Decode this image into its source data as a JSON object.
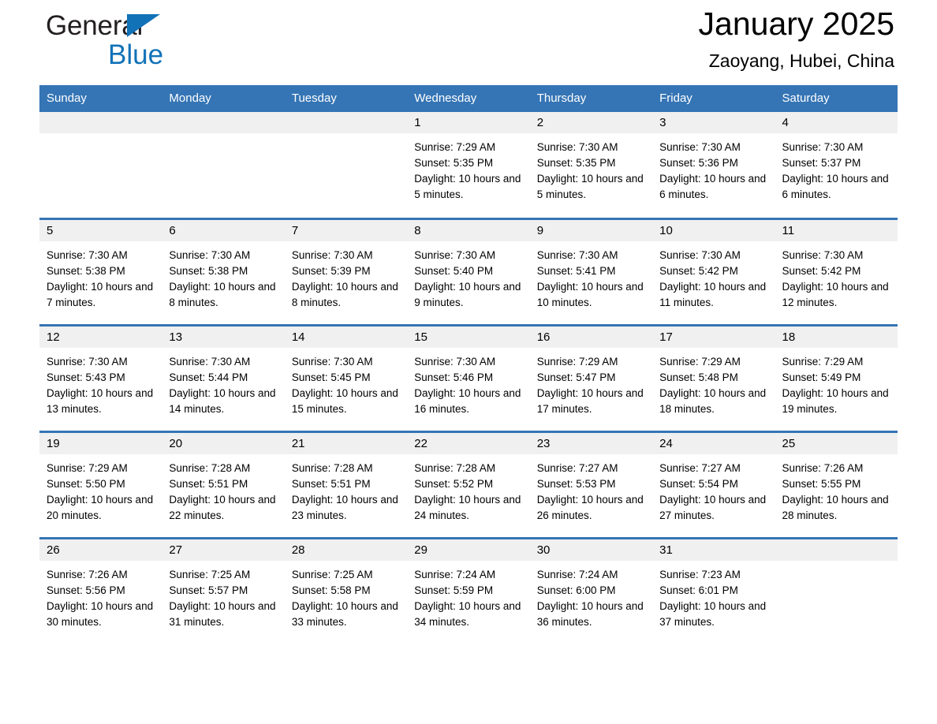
{
  "brand": {
    "name_part1": "General",
    "name_part2": "Blue",
    "triangle_color": "#1272b8"
  },
  "header": {
    "title": "January 2025",
    "subtitle": "Zaoyang, Hubei, China"
  },
  "theme": {
    "header_blue": "#3575b5",
    "daynum_band": "#f0f0f0",
    "text": "#000000"
  },
  "weekdays": [
    "Sunday",
    "Monday",
    "Tuesday",
    "Wednesday",
    "Thursday",
    "Friday",
    "Saturday"
  ],
  "weeks": [
    [
      {
        "day": "",
        "sunrise": "",
        "sunset": "",
        "daylight": "",
        "empty": true
      },
      {
        "day": "",
        "sunrise": "",
        "sunset": "",
        "daylight": "",
        "empty": true
      },
      {
        "day": "",
        "sunrise": "",
        "sunset": "",
        "daylight": "",
        "empty": true
      },
      {
        "day": "1",
        "sunrise": "Sunrise: 7:29 AM",
        "sunset": "Sunset: 5:35 PM",
        "daylight": "Daylight: 10 hours and 5 minutes."
      },
      {
        "day": "2",
        "sunrise": "Sunrise: 7:30 AM",
        "sunset": "Sunset: 5:35 PM",
        "daylight": "Daylight: 10 hours and 5 minutes."
      },
      {
        "day": "3",
        "sunrise": "Sunrise: 7:30 AM",
        "sunset": "Sunset: 5:36 PM",
        "daylight": "Daylight: 10 hours and 6 minutes."
      },
      {
        "day": "4",
        "sunrise": "Sunrise: 7:30 AM",
        "sunset": "Sunset: 5:37 PM",
        "daylight": "Daylight: 10 hours and 6 minutes."
      }
    ],
    [
      {
        "day": "5",
        "sunrise": "Sunrise: 7:30 AM",
        "sunset": "Sunset: 5:38 PM",
        "daylight": "Daylight: 10 hours and 7 minutes."
      },
      {
        "day": "6",
        "sunrise": "Sunrise: 7:30 AM",
        "sunset": "Sunset: 5:38 PM",
        "daylight": "Daylight: 10 hours and 8 minutes."
      },
      {
        "day": "7",
        "sunrise": "Sunrise: 7:30 AM",
        "sunset": "Sunset: 5:39 PM",
        "daylight": "Daylight: 10 hours and 8 minutes."
      },
      {
        "day": "8",
        "sunrise": "Sunrise: 7:30 AM",
        "sunset": "Sunset: 5:40 PM",
        "daylight": "Daylight: 10 hours and 9 minutes."
      },
      {
        "day": "9",
        "sunrise": "Sunrise: 7:30 AM",
        "sunset": "Sunset: 5:41 PM",
        "daylight": "Daylight: 10 hours and 10 minutes."
      },
      {
        "day": "10",
        "sunrise": "Sunrise: 7:30 AM",
        "sunset": "Sunset: 5:42 PM",
        "daylight": "Daylight: 10 hours and 11 minutes."
      },
      {
        "day": "11",
        "sunrise": "Sunrise: 7:30 AM",
        "sunset": "Sunset: 5:42 PM",
        "daylight": "Daylight: 10 hours and 12 minutes."
      }
    ],
    [
      {
        "day": "12",
        "sunrise": "Sunrise: 7:30 AM",
        "sunset": "Sunset: 5:43 PM",
        "daylight": "Daylight: 10 hours and 13 minutes."
      },
      {
        "day": "13",
        "sunrise": "Sunrise: 7:30 AM",
        "sunset": "Sunset: 5:44 PM",
        "daylight": "Daylight: 10 hours and 14 minutes."
      },
      {
        "day": "14",
        "sunrise": "Sunrise: 7:30 AM",
        "sunset": "Sunset: 5:45 PM",
        "daylight": "Daylight: 10 hours and 15 minutes."
      },
      {
        "day": "15",
        "sunrise": "Sunrise: 7:30 AM",
        "sunset": "Sunset: 5:46 PM",
        "daylight": "Daylight: 10 hours and 16 minutes."
      },
      {
        "day": "16",
        "sunrise": "Sunrise: 7:29 AM",
        "sunset": "Sunset: 5:47 PM",
        "daylight": "Daylight: 10 hours and 17 minutes."
      },
      {
        "day": "17",
        "sunrise": "Sunrise: 7:29 AM",
        "sunset": "Sunset: 5:48 PM",
        "daylight": "Daylight: 10 hours and 18 minutes."
      },
      {
        "day": "18",
        "sunrise": "Sunrise: 7:29 AM",
        "sunset": "Sunset: 5:49 PM",
        "daylight": "Daylight: 10 hours and 19 minutes."
      }
    ],
    [
      {
        "day": "19",
        "sunrise": "Sunrise: 7:29 AM",
        "sunset": "Sunset: 5:50 PM",
        "daylight": "Daylight: 10 hours and 20 minutes."
      },
      {
        "day": "20",
        "sunrise": "Sunrise: 7:28 AM",
        "sunset": "Sunset: 5:51 PM",
        "daylight": "Daylight: 10 hours and 22 minutes."
      },
      {
        "day": "21",
        "sunrise": "Sunrise: 7:28 AM",
        "sunset": "Sunset: 5:51 PM",
        "daylight": "Daylight: 10 hours and 23 minutes."
      },
      {
        "day": "22",
        "sunrise": "Sunrise: 7:28 AM",
        "sunset": "Sunset: 5:52 PM",
        "daylight": "Daylight: 10 hours and 24 minutes."
      },
      {
        "day": "23",
        "sunrise": "Sunrise: 7:27 AM",
        "sunset": "Sunset: 5:53 PM",
        "daylight": "Daylight: 10 hours and 26 minutes."
      },
      {
        "day": "24",
        "sunrise": "Sunrise: 7:27 AM",
        "sunset": "Sunset: 5:54 PM",
        "daylight": "Daylight: 10 hours and 27 minutes."
      },
      {
        "day": "25",
        "sunrise": "Sunrise: 7:26 AM",
        "sunset": "Sunset: 5:55 PM",
        "daylight": "Daylight: 10 hours and 28 minutes."
      }
    ],
    [
      {
        "day": "26",
        "sunrise": "Sunrise: 7:26 AM",
        "sunset": "Sunset: 5:56 PM",
        "daylight": "Daylight: 10 hours and 30 minutes."
      },
      {
        "day": "27",
        "sunrise": "Sunrise: 7:25 AM",
        "sunset": "Sunset: 5:57 PM",
        "daylight": "Daylight: 10 hours and 31 minutes."
      },
      {
        "day": "28",
        "sunrise": "Sunrise: 7:25 AM",
        "sunset": "Sunset: 5:58 PM",
        "daylight": "Daylight: 10 hours and 33 minutes."
      },
      {
        "day": "29",
        "sunrise": "Sunrise: 7:24 AM",
        "sunset": "Sunset: 5:59 PM",
        "daylight": "Daylight: 10 hours and 34 minutes."
      },
      {
        "day": "30",
        "sunrise": "Sunrise: 7:24 AM",
        "sunset": "Sunset: 6:00 PM",
        "daylight": "Daylight: 10 hours and 36 minutes."
      },
      {
        "day": "31",
        "sunrise": "Sunrise: 7:23 AM",
        "sunset": "Sunset: 6:01 PM",
        "daylight": "Daylight: 10 hours and 37 minutes."
      },
      {
        "day": "",
        "sunrise": "",
        "sunset": "",
        "daylight": "",
        "empty": true
      }
    ]
  ]
}
